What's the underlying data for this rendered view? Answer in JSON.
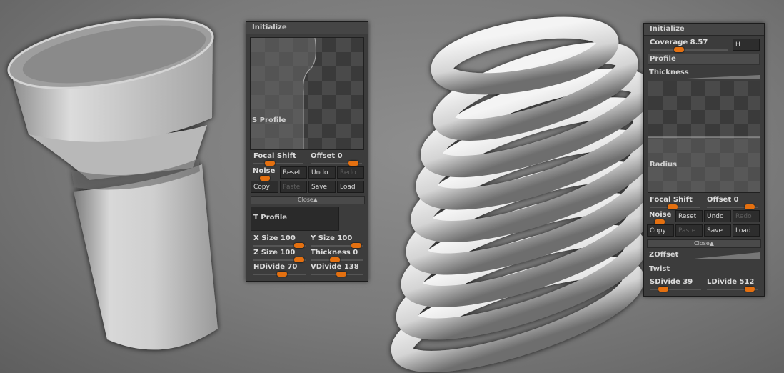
{
  "panel_left": {
    "title": "Initialize",
    "s_profile_label": "S Profile",
    "focal_shift": {
      "label": "Focal Shift",
      "value": "",
      "level": 0.28
    },
    "offset": {
      "label": "Offset",
      "value": "0",
      "level": 0.92
    },
    "noise_label": "Noise",
    "buttons": {
      "reset": "Reset",
      "undo": "Undo",
      "redo": "Redo",
      "copy": "Copy",
      "paste": "Paste",
      "save": "Save",
      "load": "Load"
    },
    "close_label": "Close▲",
    "t_profile_label": "T Profile",
    "x_size": {
      "label": "X Size",
      "value": "100",
      "level": 0.95
    },
    "y_size": {
      "label": "Y Size",
      "value": "100",
      "level": 0.95
    },
    "z_size": {
      "label": "Z Size",
      "value": "100",
      "level": 0.95
    },
    "thickness": {
      "label": "Thickness",
      "value": "0",
      "level": 0.45
    },
    "hdivide": {
      "label": "HDivide",
      "value": "70",
      "level": 0.55
    },
    "vdivide": {
      "label": "VDivide",
      "value": "138",
      "level": 0.6
    }
  },
  "panel_right": {
    "title": "Initialize",
    "coverage": {
      "label": "Coverage",
      "value": "8.57",
      "level": 0.35
    },
    "h_label": "H",
    "profile_label": "Profile",
    "thickness_label": "Thickness",
    "radius_label": "Radius",
    "focal_shift": {
      "label": "Focal Shift",
      "value": "",
      "level": 0.45
    },
    "offset": {
      "label": "Offset",
      "value": "0",
      "level": 0.92
    },
    "noise_label": "Noise",
    "buttons": {
      "reset": "Reset",
      "undo": "Undo",
      "redo": "Redo",
      "copy": "Copy",
      "paste": "Paste",
      "save": "Save",
      "load": "Load"
    },
    "close_label": "Close▲",
    "zoffset_label": "ZOffset",
    "twist_label": "Twist",
    "sdivide": {
      "label": "SDivide",
      "value": "39",
      "level": 0.2
    },
    "ldivide": {
      "label": "LDivide",
      "value": "512",
      "level": 0.92
    }
  }
}
